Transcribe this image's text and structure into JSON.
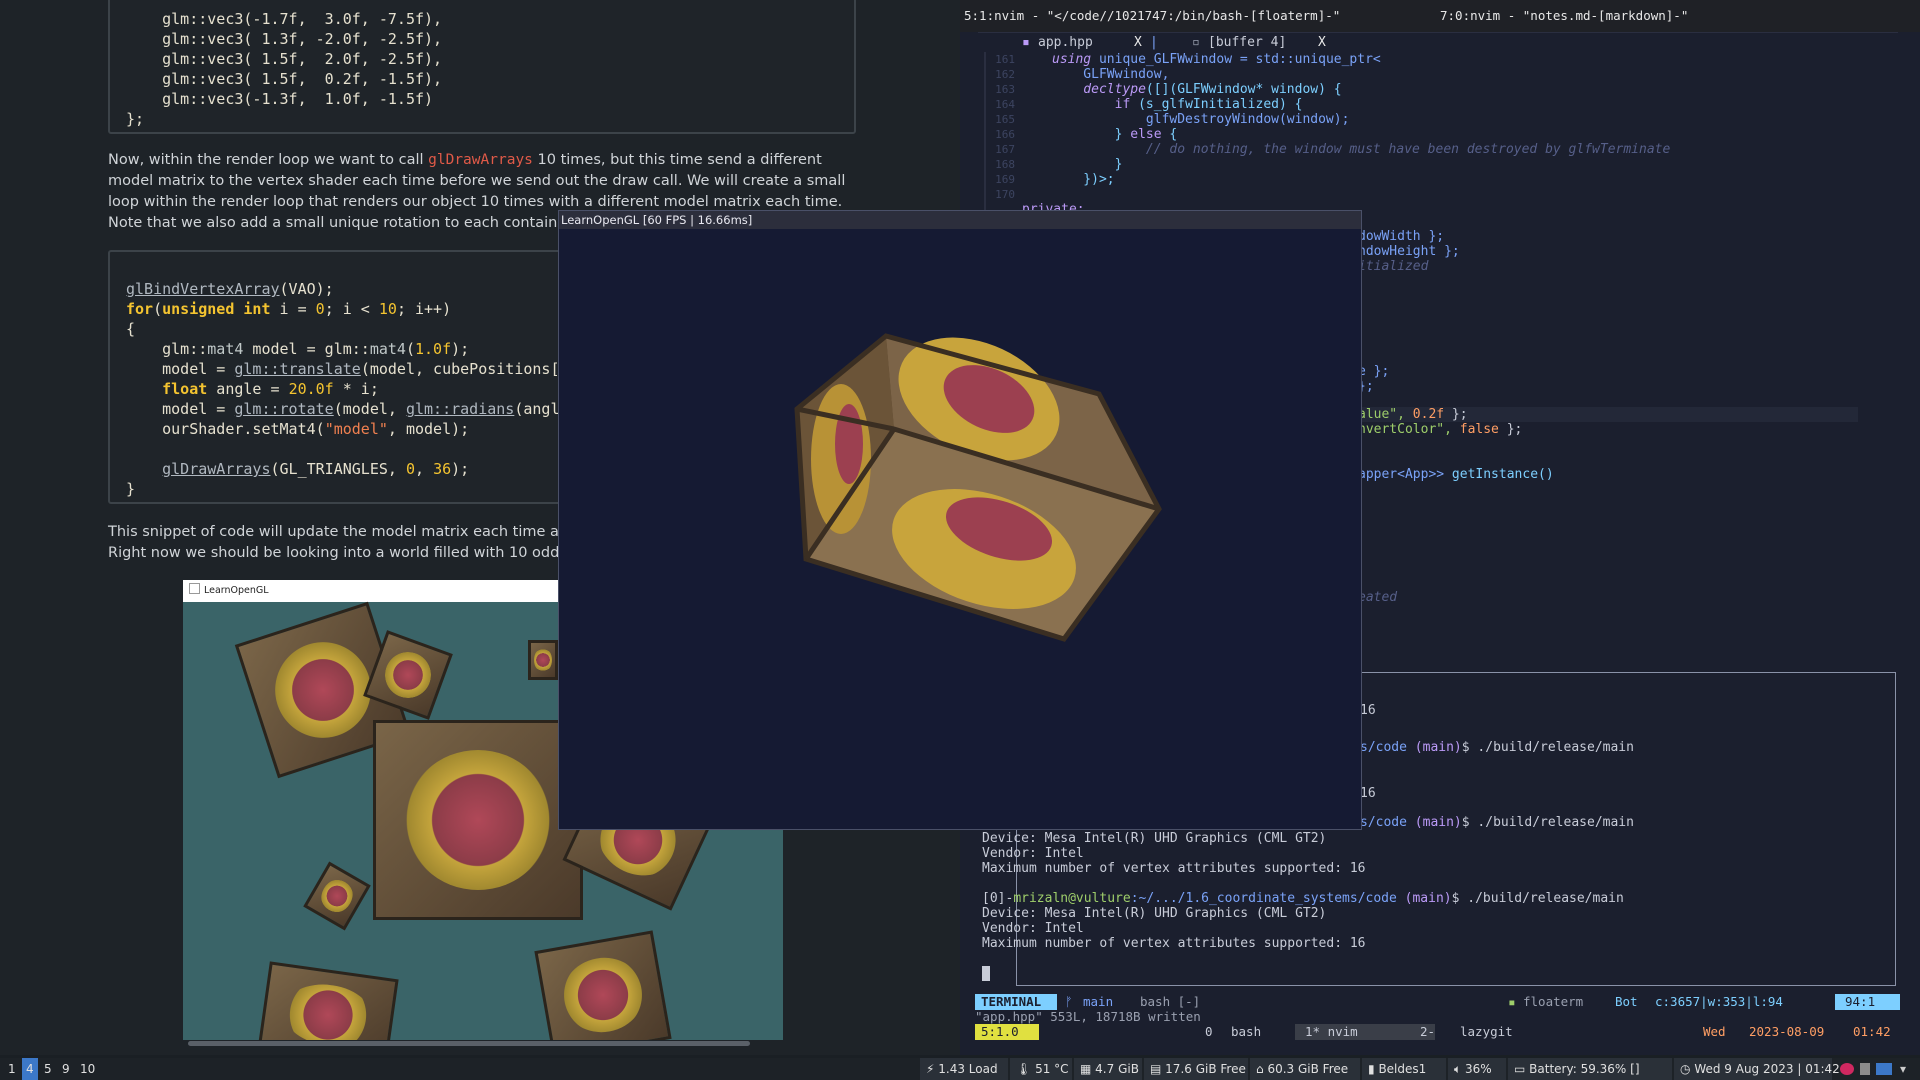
{
  "left": {
    "code1": [
      "    glm::vec3(-1.7f,  3.0f, -7.5f),",
      "    glm::vec3( 1.3f, -2.0f, -2.5f),",
      "    glm::vec3( 1.5f,  2.0f, -2.5f),",
      "    glm::vec3( 1.5f,  0.2f, -1.5f),",
      "    glm::vec3(-1.3f,  1.0f, -1.5f)",
      "};"
    ],
    "para1_a": "Now, within the render loop we want to call ",
    "para1_code": "glDrawArrays",
    "para1_b": " 10 times, but this time send a different model matrix to the vertex shader each time before we send out the draw call. We will create a small loop within the render loop that renders our object 10 times with a different model matrix each time. Note that we also add a small unique rotation to each container.",
    "code2": {
      "l1_fn": "glBindVertexArray",
      "l1_rest": "(VAO);",
      "l2_for": "for",
      "l2_unsigned": "unsigned int",
      "l2_rest_a": " i = ",
      "l2_zero": "0",
      "l2_rest_b": "; i < ",
      "l2_ten": "10",
      "l2_rest_c": "; i++)",
      "l3": "{",
      "l4_a": "    glm::",
      "l4_type": "mat4",
      "l4_b": " model = glm::",
      "l4_type2": "mat4",
      "l4_c": "(",
      "l4_num": "1.0f",
      "l4_d": ");",
      "l5_a": "    model = ",
      "l5_fn": "glm::translate",
      "l5_b": "(model, cubePositions[",
      "l6_kw": "float",
      "l6_a": " angle = ",
      "l6_num": "20.0f",
      "l6_b": " * i;",
      "l7_a": "    model = ",
      "l7_fn": "glm::rotate",
      "l7_b": "(model, ",
      "l7_fn2": "glm::radians",
      "l7_c": "(angl",
      "l8_a": "    ourShader.setMat4(",
      "l8_str": "\"model\"",
      "l8_b": ", model);",
      "l10_fn": "glDrawArrays",
      "l10_a": "(GL_TRIANGLES, ",
      "l10_zero": "0",
      "l10_b": ", ",
      "l10_num": "36",
      "l10_c": ");",
      "l11": "}"
    },
    "para2_l1": "This snippet of code will update the model matrix each time a new",
    "para2_l2": "Right now we should be looking into a world filled with 10 oddly ro",
    "shot_title": "LearnOpenGL"
  },
  "tmux": {
    "left_title": "5:1:nvim - \"</code//1021747:/bin/bash-[floaterm]-\"",
    "right_title": "7:0:nvim - \"notes.md-[markdown]-\""
  },
  "buffers": {
    "tab1": "app.hpp",
    "tab1_close": "X",
    "tab2": "[buffer 4]",
    "tab2_close": "X"
  },
  "editor": {
    "line_numbers": [
      "161",
      "162",
      "163",
      "164",
      "165",
      "166",
      "167",
      "168",
      "169",
      "170"
    ],
    "l161_kw": "using",
    "l161_rest": " unique_GLFWwindow = std::unique_ptr<",
    "l162": "    GLFWwindow,",
    "l163_kw": "    decltype",
    "l163_rest": "([](GLFWwindow* window) {",
    "l164_kw": "        if",
    "l164_rest": " (s_glfwInitialized) {",
    "l165": "            glfwDestroyWindow(window);",
    "l166_a": "        } ",
    "l166_kw": "else",
    "l166_b": " {",
    "l167": "            // do nothing, the window must have been destroyed by glfwTerminate",
    "l168": "        }",
    "l169": "    })>;",
    "l171": "private:",
    "r1": "dowWidth };",
    "r2": "ndowHeight };",
    "r3": "itialized",
    "r4": "e };",
    "r5": "};",
    "r6_a": "alue\", ",
    "r6_num": "0.2f",
    "r6_b": " };",
    "r7_a": "nvertColor\", ",
    "r7_kw": "false",
    "r7_b": " };",
    "r8_a": "apper<App>> ",
    "r8_fn": "getInstance()",
    "r9": "eated"
  },
  "terminal": {
    "p1": "16",
    "p2_a": "s/code ",
    "p2_b": "(main)",
    "p2_c": "$ ./build/release/main",
    "p3": "16",
    "p4_a": "s/code ",
    "p4_b": "(main)",
    "p4_c": "$ ./build/release/main",
    "l1": "Device: Mesa Intel(R) UHD Graphics (CML GT2)",
    "l2": "Vendor: Intel",
    "l3": "Maximum number of vertex attributes supported: 16",
    "prompt_num": "[0]-",
    "prompt_user": "mrizaln@vulture",
    "prompt_path": ":~/.../1.6_coordinate_systems/code ",
    "prompt_branch": "(main)",
    "prompt_cmd": "$ ./build/release/main",
    "l4": "Device: Mesa Intel(R) UHD Graphics (CML GT2)",
    "l5": "Vendor: Intel",
    "l6": "Maximum number of vertex attributes supported: 16"
  },
  "statusline": {
    "mode": "TERMINAL",
    "branch": "main",
    "file": "bash [-]",
    "floaterm": "floaterm",
    "pos_label": "Bot",
    "stats": "c:3657|w:353|l:94",
    "cursor": "94:1",
    "message": "\"app.hpp\" 553L, 18718B written"
  },
  "tmuxbar": {
    "session": "5:1.0",
    "w0": "0",
    "w0_name": "bash",
    "w1": "1*",
    "w1_name": "nvim",
    "w2": "2-",
    "w2_name": "lazygit",
    "day": "Wed",
    "date": "2023-08-09",
    "time": "01:42"
  },
  "glwindow": {
    "title": "LearnOpenGL [60 FPS | 16.66ms]"
  },
  "bar": {
    "workspaces": [
      "1",
      "4",
      "5",
      "9",
      "10"
    ],
    "active_workspace": "4",
    "load": "1.43 Load",
    "temp": "51 °C",
    "mem": "4.7 GiB",
    "disk1": "17.6 GiB Free",
    "disk2": "60.3 GiB Free",
    "wifi": "Beldes1",
    "volume": "36%",
    "battery": "Battery: 59.36% []",
    "clock": "Wed 9 Aug 2023 | 01:42"
  },
  "colors": {
    "accent": "#7aa2f7",
    "terminal_mode": "#7dcfff",
    "session": "#e0e040",
    "orange": "#ff9e64"
  },
  "icons": {
    "clock": "clock-icon",
    "battery": "battery-icon",
    "volume": "volume-icon",
    "wifi": "wifi-icon",
    "disk": "disk-icon",
    "memory": "memory-icon",
    "temp": "thermometer-icon",
    "load": "cpu-icon"
  }
}
